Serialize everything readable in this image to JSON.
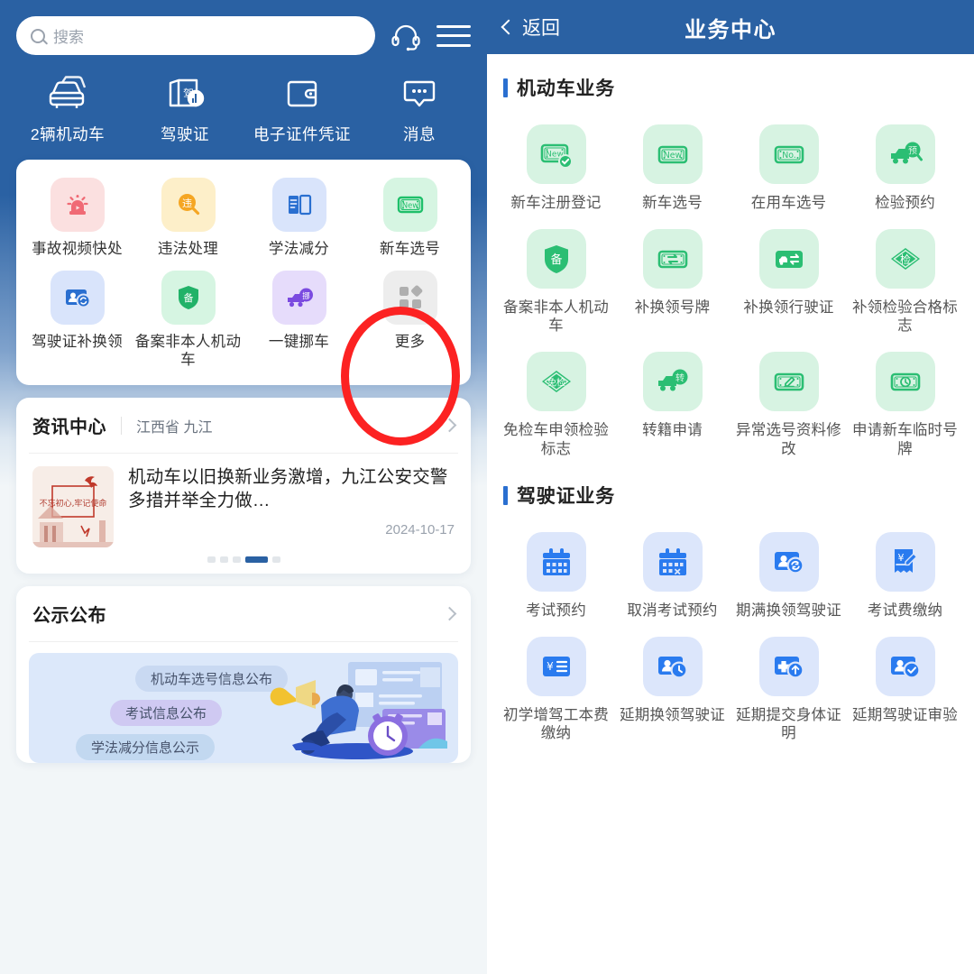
{
  "colors": {
    "brand_blue": "#2A61A3",
    "highlight_red": "#FC2222",
    "accent_blue": "#2A6FD0",
    "page_bg": "#F2F6F8"
  },
  "left_panel": {
    "search": {
      "placeholder": "搜索",
      "icon": "search-icon"
    },
    "header_icons": [
      {
        "name": "headset-icon",
        "label": "客服"
      },
      {
        "name": "menu-icon",
        "label": "菜单"
      }
    ],
    "quick_nav": [
      {
        "label": "2辆机动车",
        "icon": "car-icon"
      },
      {
        "label": "驾驶证",
        "icon": "driver-license-icon"
      },
      {
        "label": "电子证件凭证",
        "icon": "wallet-icon"
      },
      {
        "label": "消息",
        "icon": "message-icon"
      }
    ],
    "service_grid": [
      {
        "label": "事故视频快处",
        "icon": "siren-icon",
        "bg": "#FBE0E0",
        "fg": "#F06A75"
      },
      {
        "label": "违法处理",
        "icon": "violation-search-icon",
        "bg": "#FDEFC9",
        "fg": "#F5A623"
      },
      {
        "label": "学法减分",
        "icon": "book-icon",
        "bg": "#D9E4FB",
        "fg": "#2A6FD0"
      },
      {
        "label": "新车选号",
        "icon": "new-plate-icon",
        "bg": "#D6F5E2",
        "fg": "#1FBF6A"
      },
      {
        "label": "驾驶证补换领",
        "icon": "license-renew-icon",
        "bg": "#D9E4FB",
        "fg": "#2A6FD0"
      },
      {
        "label": "备案非本人机动车",
        "icon": "shield-record-icon",
        "bg": "#D6F5E2",
        "fg": "#21B268"
      },
      {
        "label": "一键挪车",
        "icon": "move-car-icon",
        "bg": "#E6DCFB",
        "fg": "#7B4BE0"
      },
      {
        "label": "更多",
        "icon": "more-grid-icon",
        "bg": "#EDEDED",
        "fg": "#AFAFAF",
        "highlighted": true
      }
    ],
    "news_card": {
      "title": "资讯中心",
      "location": "江西省 九江",
      "chevron": "chevron-right-icon",
      "item": {
        "headline": "机动车以旧换新业务激增，九江公安交警多措并举全力做…",
        "date": "2024-10-17",
        "thumb_text": "不忘初心，牢记使命"
      },
      "carousel": {
        "count": 5,
        "active_index": 3
      }
    },
    "notice_card": {
      "title": "公示公布",
      "chevron": "chevron-right-icon",
      "pills": [
        "机动车选号信息公布",
        "考试信息公布",
        "学法减分信息公示"
      ]
    }
  },
  "right_panel": {
    "navbar": {
      "back_label": "返回",
      "back_icon": "chevron-left-icon",
      "title": "业务中心"
    },
    "sections": [
      {
        "title": "机动车业务",
        "items": [
          {
            "label": "新车注册登记",
            "icon": "new-plate-check-icon",
            "bg": "#D7F3E2",
            "fg": "#2BBE73"
          },
          {
            "label": "新车选号",
            "icon": "new-plate-icon",
            "bg": "#D7F3E2",
            "fg": "#2BBE73"
          },
          {
            "label": "在用车选号",
            "icon": "plate-no-icon",
            "bg": "#D7F3E2",
            "fg": "#2BBE73"
          },
          {
            "label": "检验预约",
            "icon": "inspection-booking-icon",
            "bg": "#D7F3E2",
            "fg": "#2BBE73"
          },
          {
            "label": "备案非本人机动车",
            "icon": "shield-record-icon",
            "bg": "#D7F3E2",
            "fg": "#2BBE73"
          },
          {
            "label": "补换领号牌",
            "icon": "plate-swap-icon",
            "bg": "#D7F3E2",
            "fg": "#2BBE73"
          },
          {
            "label": "补换领行驶证",
            "icon": "vehicle-license-swap-icon",
            "bg": "#D7F3E2",
            "fg": "#2BBE73"
          },
          {
            "label": "补领检验合格标志",
            "icon": "inspection-badge-icon",
            "bg": "#D7F3E2",
            "fg": "#2BBE73"
          },
          {
            "label": "免检车申领检验标志",
            "icon": "exempt-badge-icon",
            "bg": "#D7F3E2",
            "fg": "#2BBE73"
          },
          {
            "label": "转籍申请",
            "icon": "transfer-vehicle-icon",
            "bg": "#D7F3E2",
            "fg": "#2BBE73"
          },
          {
            "label": "异常选号资料修改",
            "icon": "plate-edit-icon",
            "bg": "#D7F3E2",
            "fg": "#2BBE73"
          },
          {
            "label": "申请新车临时号牌",
            "icon": "temp-plate-icon",
            "bg": "#D7F3E2",
            "fg": "#2BBE73"
          }
        ]
      },
      {
        "title": "驾驶证业务",
        "items": [
          {
            "label": "考试预约",
            "icon": "calendar-icon",
            "bg": "#DCE6FB",
            "fg": "#2A7BEF"
          },
          {
            "label": "取消考试预约",
            "icon": "calendar-cancel-icon",
            "bg": "#DCE6FB",
            "fg": "#2A7BEF"
          },
          {
            "label": "期满换领驾驶证",
            "icon": "license-renew-icon",
            "bg": "#DCE6FB",
            "fg": "#2A7BEF",
            "highlighted": true
          },
          {
            "label": "考试费缴纳",
            "icon": "fee-receipt-icon",
            "bg": "#DCE6FB",
            "fg": "#2A7BEF"
          },
          {
            "label": "初学增驾工本费缴纳",
            "icon": "fee-list-icon",
            "bg": "#DCE6FB",
            "fg": "#2A7BEF"
          },
          {
            "label": "延期换领驾驶证",
            "icon": "license-clock-icon",
            "bg": "#DCE6FB",
            "fg": "#2A7BEF"
          },
          {
            "label": "延期提交身体证明",
            "icon": "medical-upload-icon",
            "bg": "#DCE6FB",
            "fg": "#2A7BEF"
          },
          {
            "label": "延期驾驶证审验",
            "icon": "license-check-icon",
            "bg": "#DCE6FB",
            "fg": "#2A7BEF"
          }
        ]
      }
    ]
  }
}
